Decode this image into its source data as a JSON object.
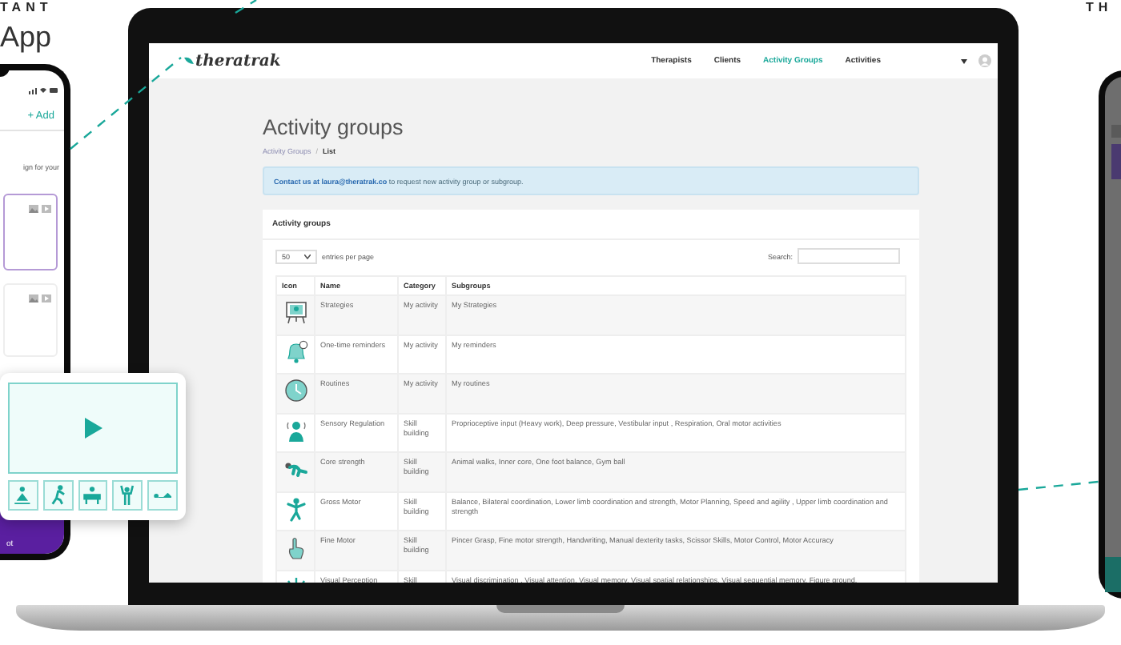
{
  "backdrop": {
    "left_caption": "TANT",
    "left_title": "App",
    "right_caption": "TH"
  },
  "left_phone": {
    "add_button": "+ Add",
    "text_fragment": "ign for your",
    "footer_fragment": "ot"
  },
  "app": {
    "logo": "theratrak",
    "nav": [
      {
        "label": "Therapists",
        "selected": false
      },
      {
        "label": "Clients",
        "selected": false
      },
      {
        "label": "Activity Groups",
        "selected": true
      },
      {
        "label": "Activities",
        "selected": false
      }
    ],
    "page_title": "Activity groups",
    "breadcrumb_separator": "/",
    "breadcrumb": [
      {
        "label": "Activity Groups",
        "kind": "link"
      },
      {
        "label": "List",
        "kind": "current"
      }
    ],
    "alert": "**Contact us at laura@theratrak.co** to request new activity group or subgroup.",
    "card_title": "Activity groups",
    "page_size": "50",
    "page_size_label": "entries per page",
    "search_label": "Search:",
    "table": {
      "columns": [
        "Icon",
        "Name",
        "Category",
        "Subgroups"
      ],
      "rows": [
        {
          "name": "Strategies",
          "category": "My activity",
          "subgroups": "My Strategies"
        },
        {
          "name": "One-time reminders",
          "category": "My activity",
          "subgroups": "My reminders"
        },
        {
          "name": "Routines",
          "category": "My activity",
          "subgroups": "My routines"
        },
        {
          "name": "Sensory Regulation",
          "category": "Skill building",
          "subgroups": "Proprioceptive input (Heavy work), Deep pressure, Vestibular input , Respiration, Oral motor activities"
        },
        {
          "name": "Core strength",
          "category": "Skill building",
          "subgroups": "Animal walks, Inner core, One foot balance, Gym ball"
        },
        {
          "name": "Gross Motor",
          "category": "Skill building",
          "subgroups": "Balance, Bilateral coordination, Lower limb coordination and strength, Motor Planning, Speed and agility , Upper limb coordination and strength"
        },
        {
          "name": "Fine Motor",
          "category": "Skill building",
          "subgroups": "Pincer Grasp, Fine motor strength, Handwriting, Manual dexterity tasks, Scissor Skills, Motor Control, Motor Accuracy"
        },
        {
          "name": "Visual Perception",
          "category": "Skill",
          "subgroups": "Visual discrimination , Visual attention, Visual memory, Visual spatial relationships, Visual sequential memory, Figure ground,"
        }
      ]
    }
  }
}
